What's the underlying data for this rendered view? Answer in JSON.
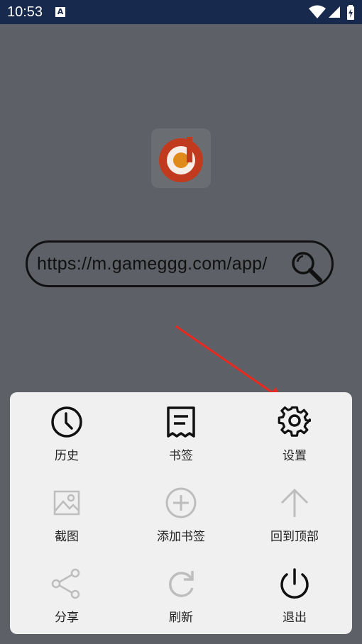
{
  "status_bar": {
    "time": "10:53",
    "notification_icon": "A",
    "icons": [
      "wifi-icon",
      "cell-signal-icon",
      "battery-icon"
    ]
  },
  "search": {
    "value": "https://m.gameggg.com/app/",
    "icon": "search-icon"
  },
  "colors": {
    "logo_red": "#c23a1e",
    "logo_orange": "#e08a1c",
    "arrow_red": "#e8291f",
    "menu_bg": "#f0f0f0",
    "active_icon": "#111111",
    "disabled_icon": "#bdbdbd"
  },
  "menu": {
    "items": [
      {
        "label": "历史",
        "icon": "history-clock-icon",
        "enabled": true
      },
      {
        "label": "书签",
        "icon": "bookmark-receipt-icon",
        "enabled": true
      },
      {
        "label": "设置",
        "icon": "settings-gear-icon",
        "enabled": true
      },
      {
        "label": "截图",
        "icon": "screenshot-image-icon",
        "enabled": false
      },
      {
        "label": "添加书签",
        "icon": "add-bookmark-plus-icon",
        "enabled": false
      },
      {
        "label": "回到顶部",
        "icon": "back-to-top-arrow-icon",
        "enabled": false
      },
      {
        "label": "分享",
        "icon": "share-icon",
        "enabled": false
      },
      {
        "label": "刷新",
        "icon": "refresh-icon",
        "enabled": false
      },
      {
        "label": "退出",
        "icon": "power-exit-icon",
        "enabled": true
      }
    ]
  }
}
